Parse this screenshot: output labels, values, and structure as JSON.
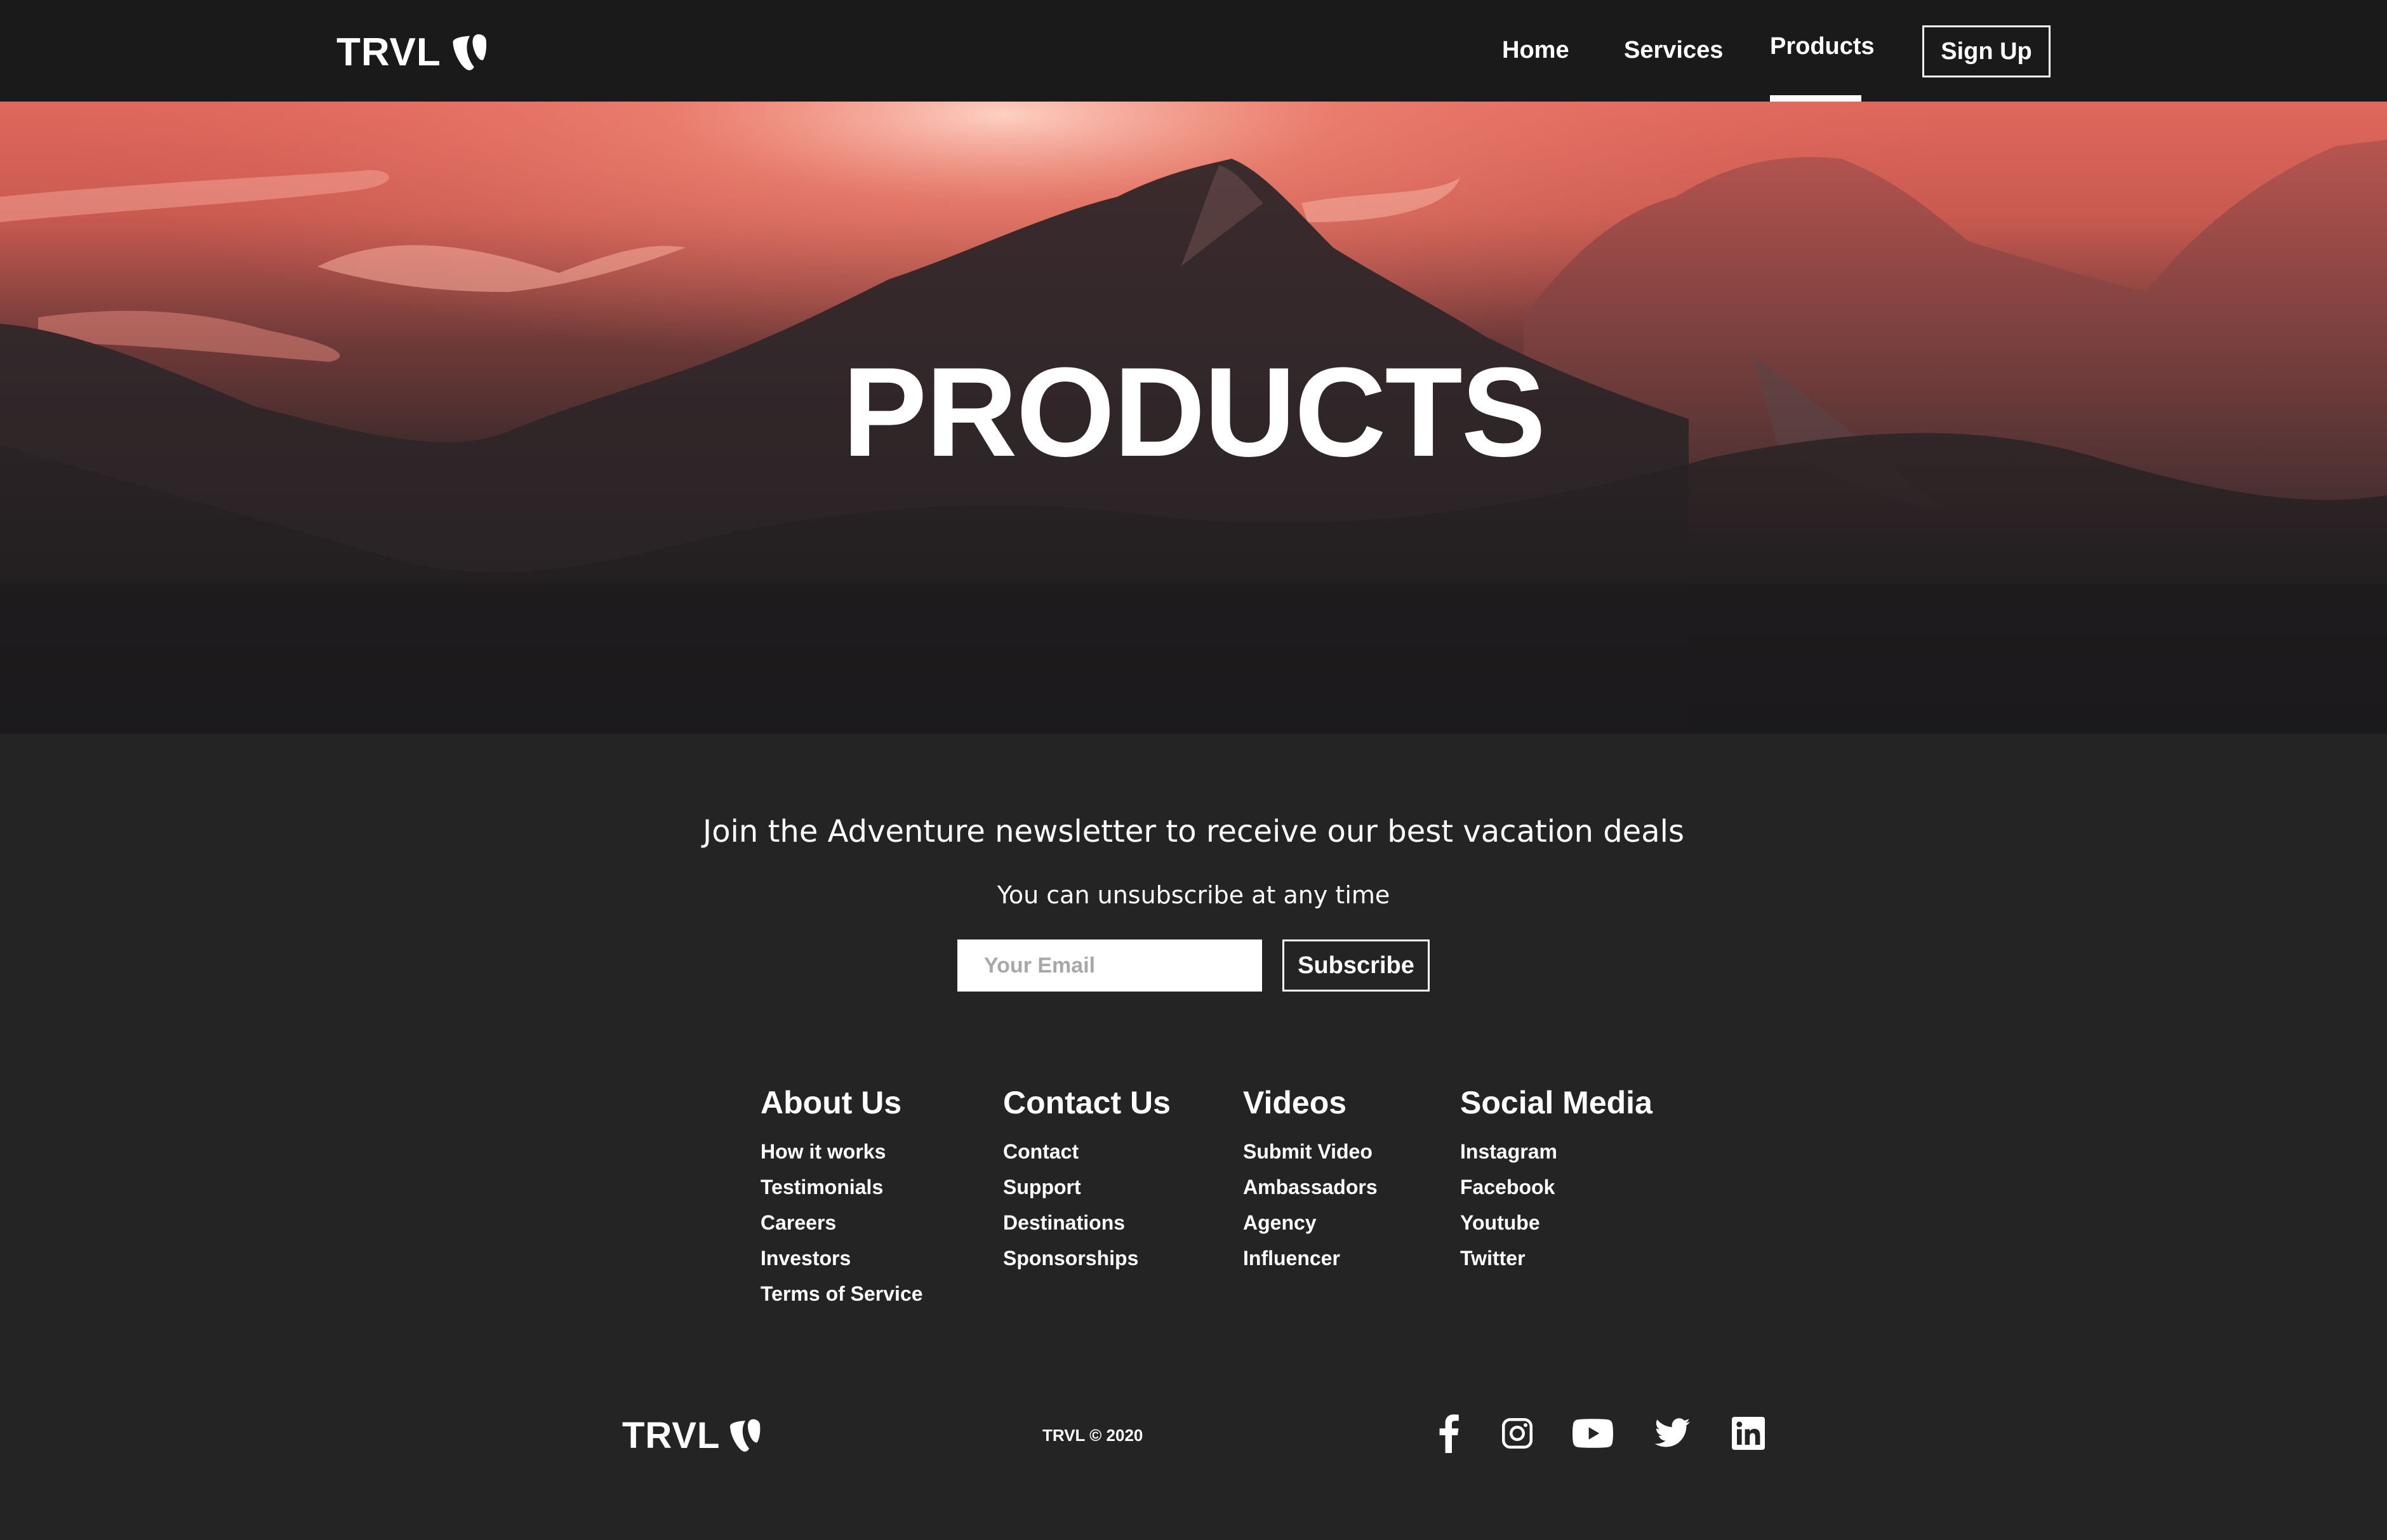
{
  "nav": {
    "logo_text": "TRVL",
    "links": [
      {
        "label": "Home"
      },
      {
        "label": "Services"
      },
      {
        "label": "Products",
        "active": true
      }
    ],
    "signup_label": "Sign Up"
  },
  "hero": {
    "title": "PRODUCTS"
  },
  "newsletter": {
    "heading": "Join the Adventure newsletter to receive our best vacation deals",
    "subheading": "You can unsubscribe at any time",
    "email_placeholder": "Your Email",
    "email_value": "",
    "subscribe_label": "Subscribe"
  },
  "footer": {
    "columns": [
      {
        "title": "About Us",
        "links": [
          "How it works",
          "Testimonials",
          "Careers",
          "Investors",
          "Terms of Service"
        ]
      },
      {
        "title": "Contact Us",
        "links": [
          "Contact",
          "Support",
          "Destinations",
          "Sponsorships"
        ]
      },
      {
        "title": "Videos",
        "links": [
          "Submit Video",
          "Ambassadors",
          "Agency",
          "Influencer"
        ]
      },
      {
        "title": "Social Media",
        "links": [
          "Instagram",
          "Facebook",
          "Youtube",
          "Twitter"
        ]
      }
    ],
    "logo_text": "TRVL",
    "copyright": "TRVL © 2020",
    "social_icons": [
      "facebook-icon",
      "instagram-icon",
      "youtube-icon",
      "twitter-icon",
      "linkedin-icon"
    ]
  },
  "colors": {
    "navbar_bg": "#1b1a1a",
    "page_bg": "#242424",
    "hero_accent": "#e0685c",
    "text": "#ffffff"
  }
}
